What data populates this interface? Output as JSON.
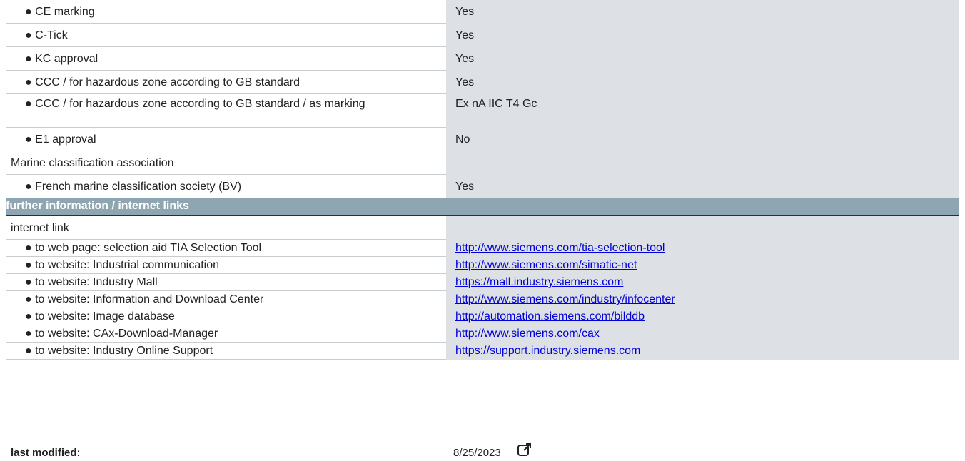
{
  "rows_top": [
    {
      "label": "● CE marking",
      "value": "Yes",
      "indent": true
    },
    {
      "label": "● C-Tick",
      "value": "Yes",
      "indent": true
    },
    {
      "label": "● KC approval",
      "value": "Yes",
      "indent": true
    },
    {
      "label": "● CCC / for hazardous zone according to GB standard",
      "value": "Yes",
      "indent": true
    },
    {
      "label": "● CCC / for hazardous zone according to GB standard / as marking",
      "value": "Ex nA IIC T4 Gc",
      "indent": true,
      "tall": true
    },
    {
      "label": "● E1 approval",
      "value": "No",
      "indent": true
    },
    {
      "label": "Marine classification association",
      "value": "",
      "indent": false
    },
    {
      "label": "● French marine classification society (BV)",
      "value": "Yes",
      "indent": true
    }
  ],
  "section": {
    "title": "further information / internet links"
  },
  "rows_links": [
    {
      "label": "internet link",
      "value": "",
      "indent": false
    },
    {
      "label": "● to web page: selection aid TIA Selection Tool",
      "value": "http://www.siemens.com/tia-selection-tool",
      "indent": true,
      "link": true
    },
    {
      "label": "● to website: Industrial communication",
      "value": "http://www.siemens.com/simatic-net",
      "indent": true,
      "link": true
    },
    {
      "label": "● to website: Industry Mall",
      "value": "https://mall.industry.siemens.com",
      "indent": true,
      "link": true
    },
    {
      "label": "● to website: Information and Download Center",
      "value": "http://www.siemens.com/industry/infocenter",
      "indent": true,
      "link": true
    },
    {
      "label": "● to website: Image database",
      "value": "http://automation.siemens.com/bilddb",
      "indent": true,
      "link": true
    },
    {
      "label": "● to website: CAx-Download-Manager",
      "value": "http://www.siemens.com/cax",
      "indent": true,
      "link": true
    },
    {
      "label": "● to website: Industry Online Support",
      "value": "https://support.industry.siemens.com",
      "indent": true,
      "link": true
    }
  ],
  "footer": {
    "label": "last modified:",
    "date": "8/25/2023",
    "icon": "external-link-icon"
  }
}
